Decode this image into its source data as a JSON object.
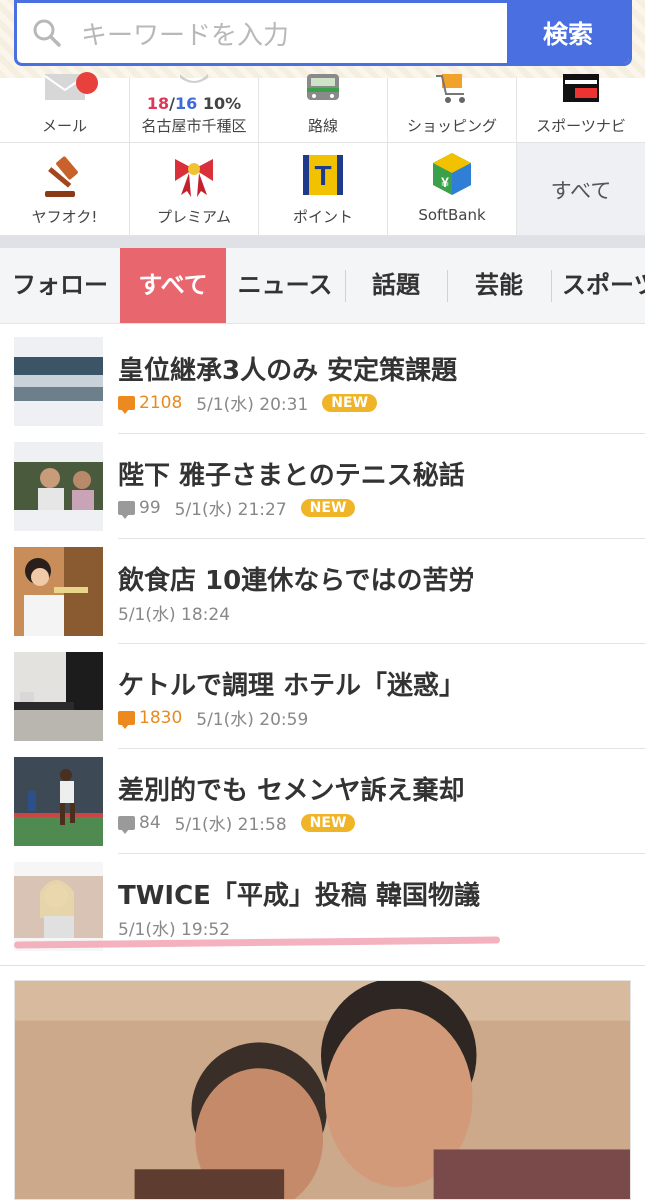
{
  "search": {
    "placeholder": "キーワードを入力",
    "button_label": "検索"
  },
  "services": {
    "row1": [
      {
        "label": "メール",
        "icon": "mail-icon"
      },
      {
        "label": "名古屋市千種区",
        "icon": "weather",
        "temp_high": "18",
        "temp_sep": "/",
        "temp_low": "16",
        "precip": "10%"
      },
      {
        "label": "路線",
        "icon": "train-icon"
      },
      {
        "label": "ショッピング",
        "icon": "shopping-cart-icon"
      },
      {
        "label": "スポーツナビ",
        "icon": "sportsnavi-logo"
      }
    ],
    "row2": [
      {
        "label": "ヤフオク!",
        "icon": "auction-gavel-icon"
      },
      {
        "label": "プレミアム",
        "icon": "premium-ribbon-icon"
      },
      {
        "label": "ポイント",
        "icon": "tpoint-icon"
      },
      {
        "label": "SoftBank",
        "icon": "softbank-icon"
      },
      {
        "label": "すべて",
        "icon": ""
      }
    ],
    "tpoint_letter": "T",
    "softbank_symbol": "¥"
  },
  "tabs": [
    "フォロー",
    "すべて",
    "ニュース",
    "話題",
    "芸能",
    "スポーツ"
  ],
  "active_tab": "すべて",
  "news": [
    {
      "title": "皇位継承3人のみ 安定策課題",
      "comments": "2108",
      "comment_style": "hot",
      "date": "5/1(水) 20:31",
      "badge": "NEW"
    },
    {
      "title": "陛下 雅子さまとのテニス秘話",
      "comments": "99",
      "comment_style": "normal",
      "date": "5/1(水) 21:27",
      "badge": "NEW"
    },
    {
      "title": "飲食店 10連休ならではの苦労",
      "comments": "",
      "comment_style": "",
      "date": "5/1(水) 18:24",
      "badge": ""
    },
    {
      "title": "ケトルで調理 ホテル「迷惑」",
      "comments": "1830",
      "comment_style": "hot",
      "date": "5/1(水) 20:59",
      "badge": ""
    },
    {
      "title": "差別的でも セメンヤ訴え棄却",
      "comments": "84",
      "comment_style": "normal",
      "date": "5/1(水) 21:58",
      "badge": "NEW"
    },
    {
      "title": "TWICE「平成」投稿 韓国物議",
      "comments": "",
      "comment_style": "",
      "date": "5/1(水) 19:52",
      "badge": ""
    }
  ],
  "colors": {
    "accent_blue": "#4a6fe0",
    "active_tab": "#e8666d",
    "new_badge": "#f0b429",
    "hot_comment": "#ec8a20"
  }
}
